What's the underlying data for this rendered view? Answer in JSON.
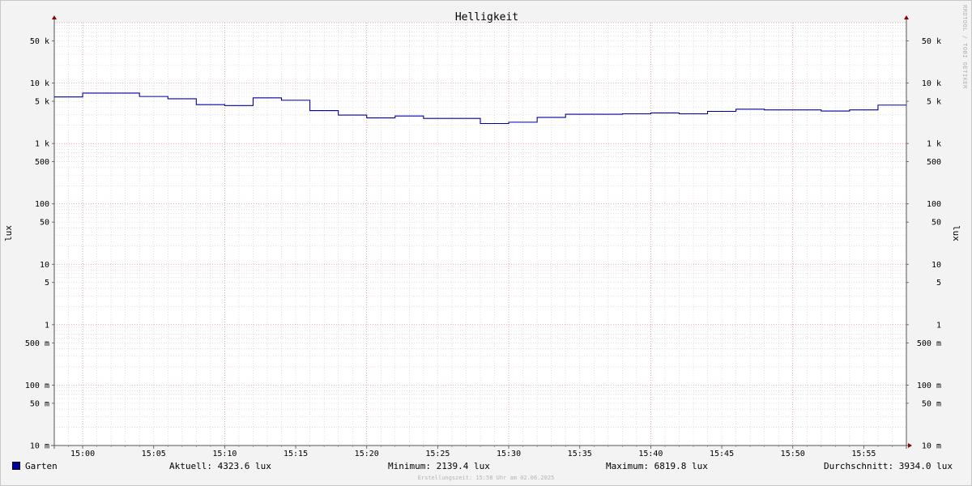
{
  "chart_data": {
    "type": "line",
    "title": "Helligkeit",
    "ylabel": "lux",
    "ylabel_right": "lux",
    "yscale": "log",
    "ylim": [
      0.01,
      100000
    ],
    "xlim": [
      "14:58",
      "15:58"
    ],
    "y_ticks": [
      {
        "value": 50000,
        "label": "50 k"
      },
      {
        "value": 10000,
        "label": "10 k"
      },
      {
        "value": 5000,
        "label": "5 k"
      },
      {
        "value": 1000,
        "label": "1 k"
      },
      {
        "value": 500,
        "label": "500"
      },
      {
        "value": 100,
        "label": "100"
      },
      {
        "value": 50,
        "label": "50"
      },
      {
        "value": 10,
        "label": "10"
      },
      {
        "value": 5,
        "label": "5"
      },
      {
        "value": 1,
        "label": "1"
      },
      {
        "value": 0.5,
        "label": "500 m"
      },
      {
        "value": 0.1,
        "label": "100 m"
      },
      {
        "value": 0.05,
        "label": "50 m"
      },
      {
        "value": 0.01,
        "label": "10 m"
      }
    ],
    "x_ticks": [
      "15:00",
      "15:05",
      "15:10",
      "15:15",
      "15:20",
      "15:25",
      "15:30",
      "15:35",
      "15:40",
      "15:45",
      "15:50",
      "15:55"
    ],
    "grid": true,
    "series": [
      {
        "name": "Garten",
        "color": "#0000a0",
        "step": true,
        "points": [
          {
            "x": "14:58",
            "y": 5900
          },
          {
            "x": "15:00",
            "y": 6820
          },
          {
            "x": "15:04",
            "y": 6000
          },
          {
            "x": "15:06",
            "y": 5500
          },
          {
            "x": "15:08",
            "y": 4400
          },
          {
            "x": "15:10",
            "y": 4250
          },
          {
            "x": "15:12",
            "y": 5700
          },
          {
            "x": "15:14",
            "y": 5200
          },
          {
            "x": "15:16",
            "y": 3500
          },
          {
            "x": "15:18",
            "y": 2950
          },
          {
            "x": "15:20",
            "y": 2650
          },
          {
            "x": "15:22",
            "y": 2850
          },
          {
            "x": "15:24",
            "y": 2600
          },
          {
            "x": "15:28",
            "y": 2140
          },
          {
            "x": "15:30",
            "y": 2250
          },
          {
            "x": "15:32",
            "y": 2700
          },
          {
            "x": "15:34",
            "y": 3050
          },
          {
            "x": "15:38",
            "y": 3100
          },
          {
            "x": "15:40",
            "y": 3200
          },
          {
            "x": "15:42",
            "y": 3100
          },
          {
            "x": "15:44",
            "y": 3400
          },
          {
            "x": "15:46",
            "y": 3700
          },
          {
            "x": "15:48",
            "y": 3600
          },
          {
            "x": "15:52",
            "y": 3450
          },
          {
            "x": "15:54",
            "y": 3600
          },
          {
            "x": "15:56",
            "y": 4320
          }
        ]
      }
    ],
    "legend": {
      "name": "Garten",
      "aktuell": "Aktuell: 4323.6 lux",
      "minimum": "Minimum: 2139.4 lux",
      "maximum": "Maximum: 6819.8 lux",
      "durchschnitt": "Durchschnitt: 3934.0 lux"
    }
  },
  "watermark": "RRDTOOL / TOBI OETIKER",
  "footer": "Erstellungszeit: 15:58 Uhr am 02.06.2025",
  "colors": {
    "background": "#f3f3f3",
    "plot_background": "#ffffff",
    "major_grid": "#e08aa0",
    "minor_grid": "#cccccc",
    "arrow": "#8b0000"
  }
}
